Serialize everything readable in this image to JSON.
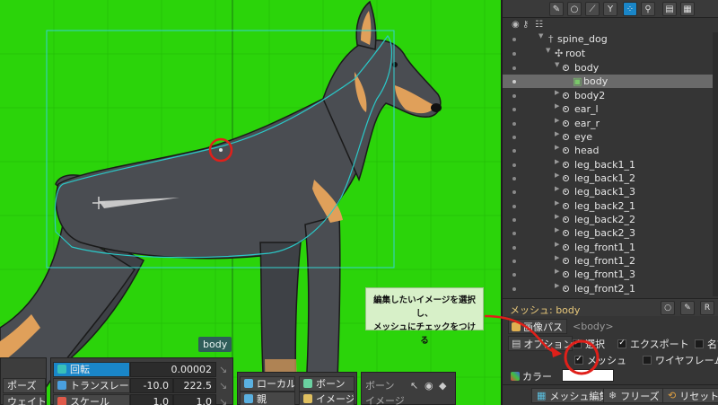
{
  "viewport": {
    "selected_label": "body",
    "bg_color": "#2bd40a"
  },
  "transform_panel": {
    "rotate": {
      "label": "回転",
      "value": "0.00002"
    },
    "translate": {
      "label": "トランスレート",
      "x": "-10.0",
      "y": "222.5"
    },
    "scale": {
      "label": "スケール",
      "x": "1.0",
      "y": "1.0"
    },
    "pose_label": "ポーズ",
    "weight_label": "ウェイト"
  },
  "axes_panel": {
    "local_label": "ローカル",
    "parent_label": "親",
    "bone_label": "ボーン",
    "image_label": "イメージ"
  },
  "filter_panel": {
    "bone_label": "ボーン",
    "image_label": "イメージ"
  },
  "tree": {
    "items": [
      {
        "label": "spine_dog",
        "indent": 0
      },
      {
        "label": "root",
        "indent": 1
      },
      {
        "label": "body",
        "indent": 2
      },
      {
        "label": "body",
        "indent": 3,
        "selected": true
      },
      {
        "label": "body2",
        "indent": 2
      },
      {
        "label": "ear_l",
        "indent": 2
      },
      {
        "label": "ear_r",
        "indent": 2
      },
      {
        "label": "eye",
        "indent": 2
      },
      {
        "label": "head",
        "indent": 2
      },
      {
        "label": "leg_back1_1",
        "indent": 2
      },
      {
        "label": "leg_back1_2",
        "indent": 2
      },
      {
        "label": "leg_back1_3",
        "indent": 2
      },
      {
        "label": "leg_back2_1",
        "indent": 2
      },
      {
        "label": "leg_back2_2",
        "indent": 2
      },
      {
        "label": "leg_back2_3",
        "indent": 2
      },
      {
        "label": "leg_front1_1",
        "indent": 2
      },
      {
        "label": "leg_front1_2",
        "indent": 2
      },
      {
        "label": "leg_front1_3",
        "indent": 2
      },
      {
        "label": "leg_front2_1",
        "indent": 2
      }
    ]
  },
  "mesh_panel": {
    "title": "メッシュ: body",
    "image_path_label": "画像パス",
    "image_path_value": "<body>",
    "options_label": "オプション",
    "select_label": "選択",
    "export_label": "エクスポート",
    "name_label": "名前",
    "mesh_label": "メッシュ",
    "wireframe_label": "ワイヤフレーム",
    "color_label": "カラー",
    "color_value": "#ffffff"
  },
  "bottom_buttons": {
    "edit_mesh": "メッシュ編集",
    "freeze": "フリーズ",
    "reset": "リセット"
  },
  "callout": {
    "line1": "編集したいイメージを選択し、",
    "line2": "メッシュにチェックをつける"
  },
  "colors": {
    "accent": "#1a86c8",
    "highlight_circle": "#e0201a",
    "mesh_title": "#e8c87a"
  }
}
